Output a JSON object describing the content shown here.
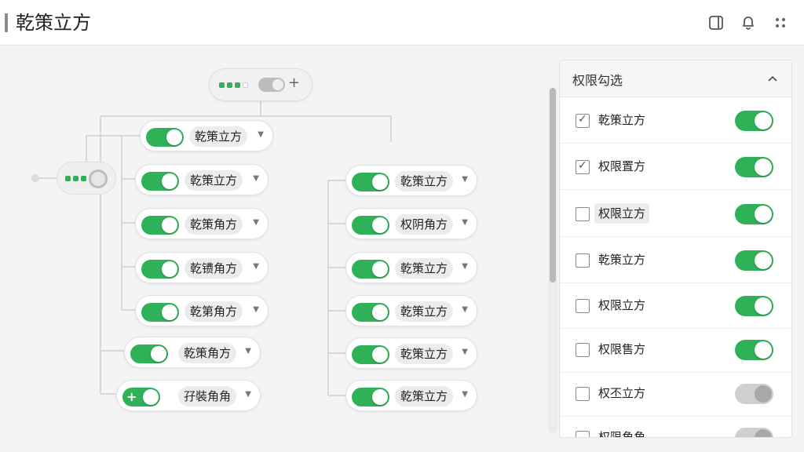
{
  "header": {
    "title": "乾策立方",
    "icons": [
      "panel-icon",
      "bell-icon",
      "more-dots-icon"
    ]
  },
  "colors": {
    "accent": "#2fb157",
    "off": "#cfcfcf"
  },
  "tree": {
    "top_node": {
      "toggle": "on",
      "plus": "+"
    },
    "left_branch": [
      {
        "label": "乾策立方",
        "on": true
      },
      {
        "label": "乾策立方",
        "on": true
      },
      {
        "label": "乾策角方",
        "on": true
      },
      {
        "label": "乾镄角方",
        "on": true
      },
      {
        "label": "乾第角方",
        "on": true
      },
      {
        "label": "乾策角方",
        "on": true
      },
      {
        "label": "孖裝角角",
        "on": true
      }
    ],
    "right_branch": [
      {
        "label": "乾策立方",
        "on": true
      },
      {
        "label": "权阴角方",
        "on": true
      },
      {
        "label": "乾策立方",
        "on": true
      },
      {
        "label": "乾策立方",
        "on": true
      },
      {
        "label": "乾策立方",
        "on": true
      },
      {
        "label": "乾策立方",
        "on": true
      }
    ]
  },
  "panel": {
    "title": "权限勾选",
    "rows": [
      {
        "label": "乾策立方",
        "checked": true,
        "enabled": true
      },
      {
        "label": "权限置方",
        "checked": true,
        "enabled": true
      },
      {
        "label": "权限立方",
        "checked": false,
        "enabled": true
      },
      {
        "label": "乾策立方",
        "checked": false,
        "enabled": true
      },
      {
        "label": "权限立方",
        "checked": false,
        "enabled": true
      },
      {
        "label": "权限售方",
        "checked": false,
        "enabled": true
      },
      {
        "label": "权丕立方",
        "checked": false,
        "enabled": false
      },
      {
        "label": "权限角角",
        "checked": false,
        "enabled": false
      }
    ]
  }
}
